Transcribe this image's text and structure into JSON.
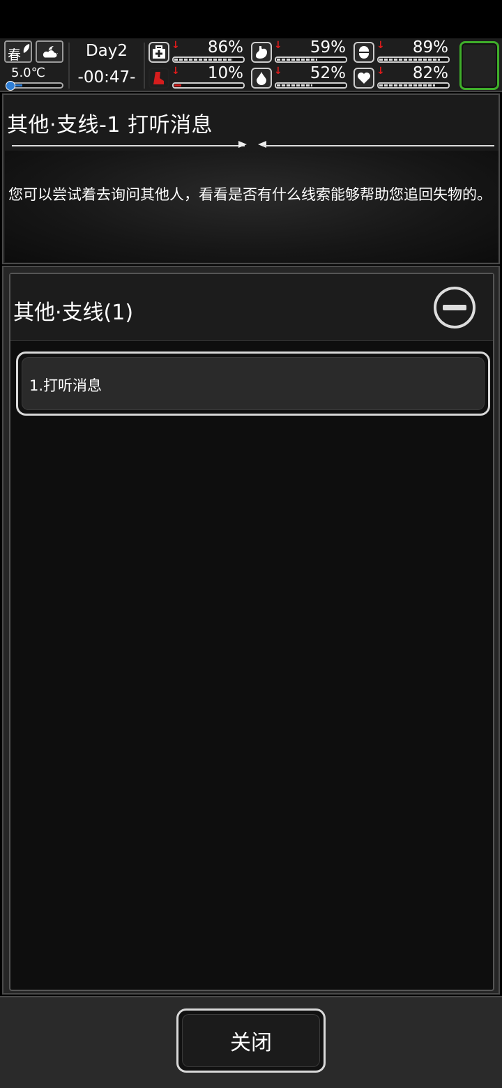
{
  "hud": {
    "season": "春",
    "temperature": "5.0℃",
    "day": "Day2",
    "time": "-00:47-",
    "stats": [
      {
        "name": "health",
        "icon": "medkit-icon",
        "value": "86%",
        "level": 0.86,
        "trend": "down"
      },
      {
        "name": "hunger",
        "icon": "stomach-icon",
        "value": "59%",
        "level": 0.59,
        "trend": "down"
      },
      {
        "name": "medicine",
        "icon": "pill-icon",
        "value": "89%",
        "level": 0.89,
        "trend": "down"
      },
      {
        "name": "stamina",
        "icon": "boot-icon",
        "value": "10%",
        "level": 0.1,
        "trend": "down"
      },
      {
        "name": "thirst",
        "icon": "water-drop-icon",
        "value": "52%",
        "level": 0.52,
        "trend": "down"
      },
      {
        "name": "mood",
        "icon": "heart-icon",
        "value": "82%",
        "level": 0.82,
        "trend": "down"
      }
    ],
    "colors": {
      "slot_border": "#3fae2a",
      "trend": "#e01b1b",
      "temp": "#2f7fd6"
    }
  },
  "quest": {
    "title": "其他·支线-1 打听消息",
    "description": "您可以尝试着去询问其他人，看看是否有什么线索能够帮助您追回失物的。"
  },
  "list": {
    "group_title": "其他·支线(1)",
    "items": [
      {
        "label": "1.打听消息"
      }
    ]
  },
  "footer": {
    "close_label": "关闭"
  }
}
